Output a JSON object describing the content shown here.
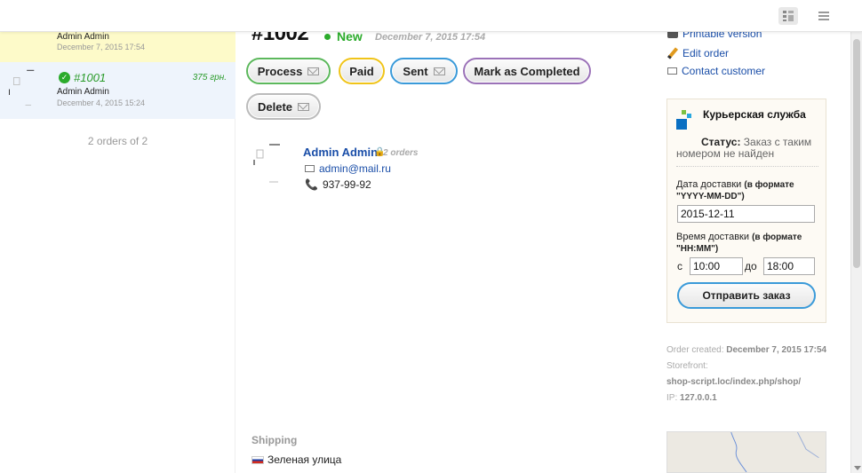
{
  "sidebar": {
    "orders": [
      {
        "customer": "Admin Admin",
        "date": "December 7, 2015 17:54"
      },
      {
        "number": "#1001",
        "price": "375 грн.",
        "customer": "Admin Admin",
        "date": "December 4, 2015 15:24"
      }
    ],
    "count_text": "2 orders of 2"
  },
  "order": {
    "number": "#1002",
    "status": "New",
    "date": "December 7, 2015 17:54",
    "status_color": "#2bab2b"
  },
  "actions": {
    "process": "Process",
    "paid": "Paid",
    "sent": "Sent",
    "complete": "Mark as Completed",
    "delete": "Delete"
  },
  "customer": {
    "name": "Admin Admin",
    "orders": "2 orders",
    "email": "admin@mail.ru",
    "phone": "937-99-92"
  },
  "shipping": {
    "title": "Shipping",
    "street": "Зеленая улица"
  },
  "links": {
    "print": "Printable version",
    "edit": "Edit order",
    "contact": "Contact customer"
  },
  "courier": {
    "title": "Курьерская служба",
    "status_label": "Статус:",
    "status_text": "Заказ с таким номером не найден",
    "date_label": "Дата доставки",
    "date_format": "(в формате \"YYYY-MM-DD\")",
    "date_value": "2015-12-11",
    "time_label": "Время доставки",
    "time_format": "(в формате \"HH:MM\")",
    "from_label": "с",
    "from_value": "10:00",
    "to_label": "до",
    "to_value": "18:00",
    "send_button": "Отправить заказ"
  },
  "meta": {
    "created_label": "Order created:",
    "created_value": "December 7, 2015 17:54",
    "storefront_label": "Storefront:",
    "storefront_value": "shop-script.loc/index.php/shop/",
    "ip_label": "IP:",
    "ip_value": "127.0.0.1"
  },
  "colors": {
    "link": "#1a4ea8",
    "highlight_row": "#fdfac9",
    "selected_row": "#eef4fc"
  }
}
